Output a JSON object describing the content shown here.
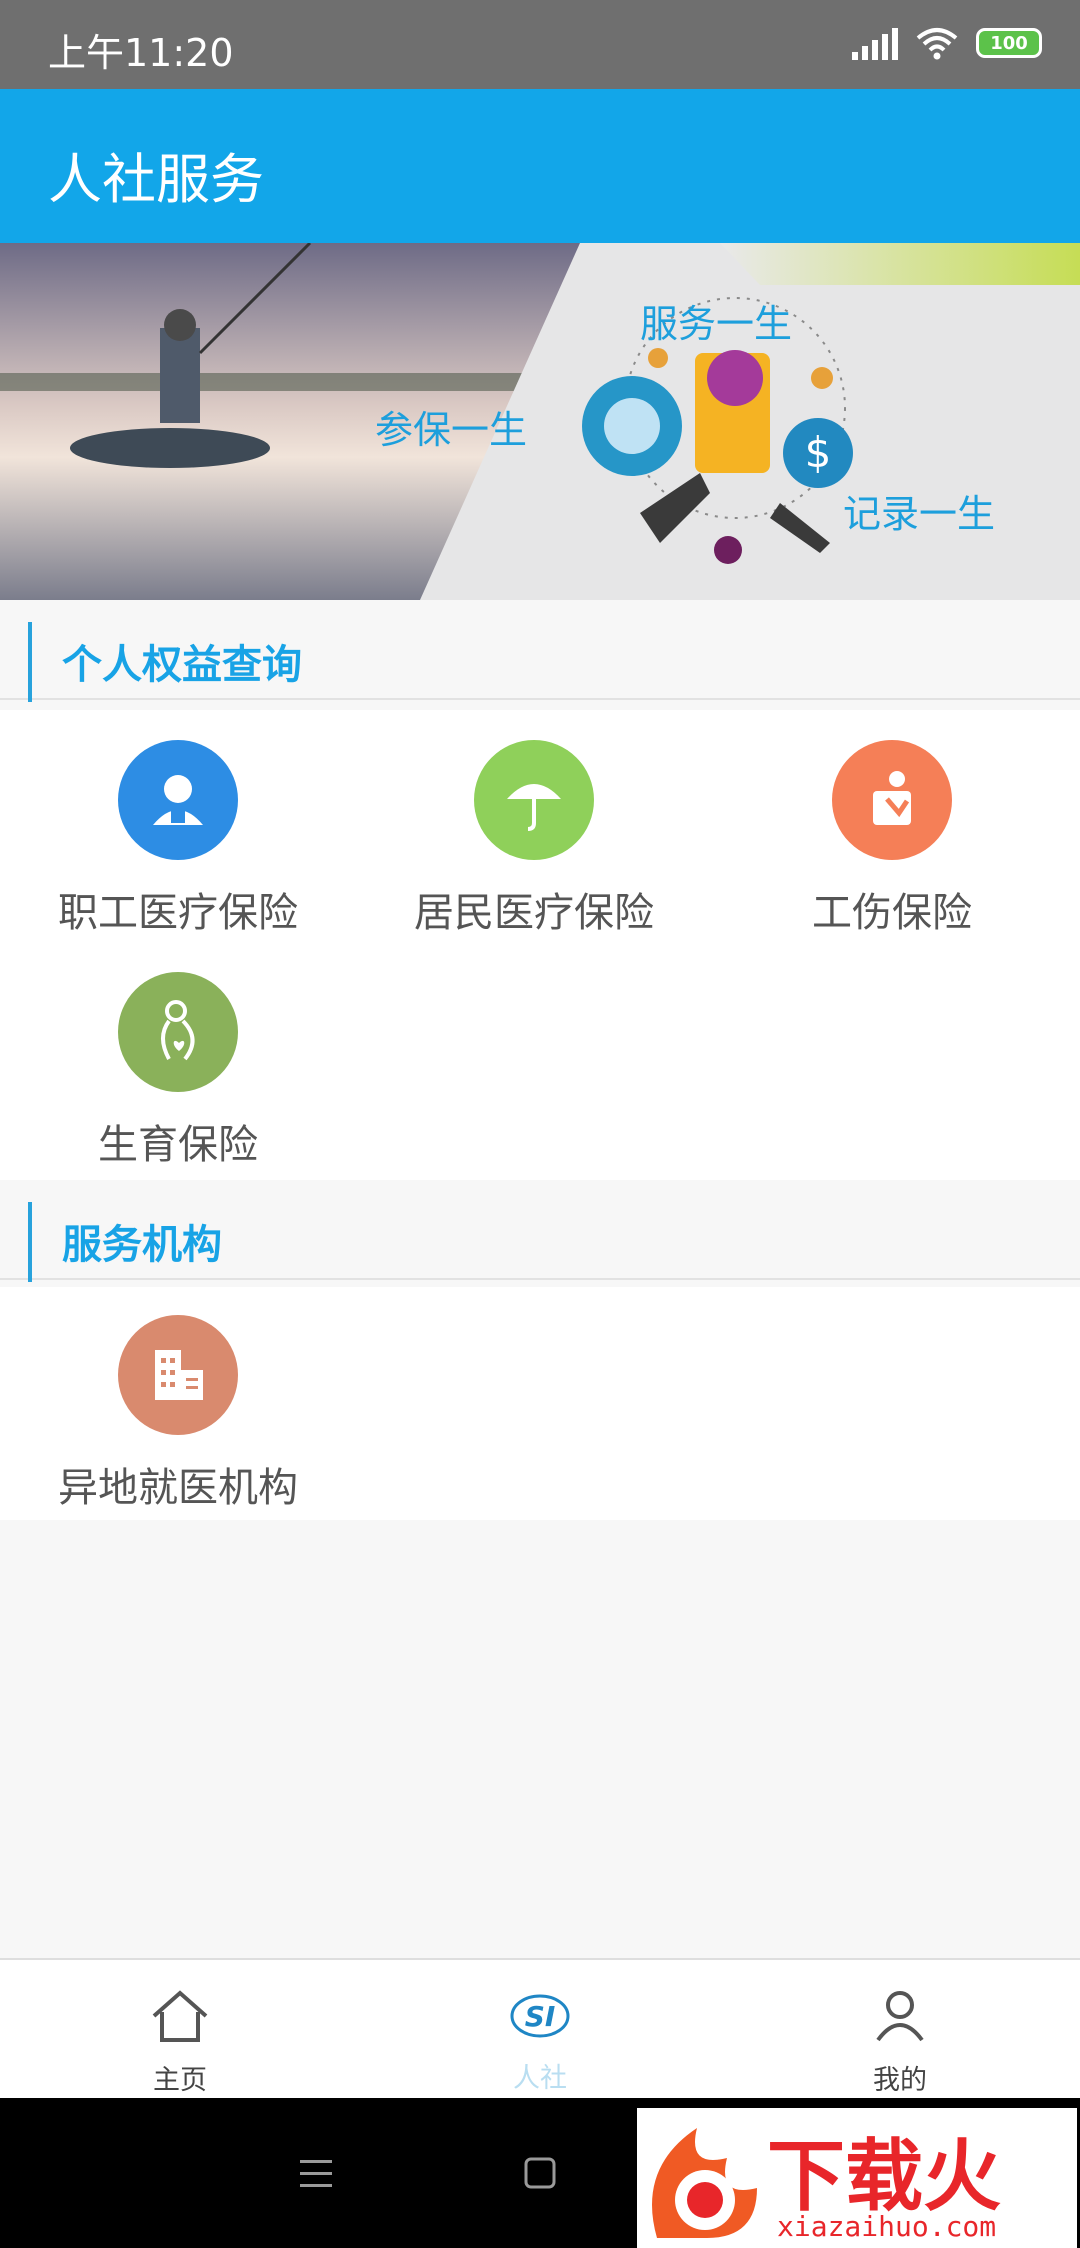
{
  "status_bar": {
    "time": "上午11:20",
    "battery": "100"
  },
  "app_bar": {
    "title": "人社服务"
  },
  "banner": {
    "text_service": "服务一生",
    "text_insure": "参保一生",
    "text_record": "记录一生"
  },
  "sections": {
    "personal": {
      "title": "个人权益查询",
      "items": [
        {
          "label": "职工医疗保险",
          "icon": "employee-icon",
          "color": "#2d8de4"
        },
        {
          "label": "居民医疗保险",
          "icon": "umbrella-icon",
          "color": "#8fd05a"
        },
        {
          "label": "工伤保险",
          "icon": "injury-icon",
          "color": "#f57f57"
        },
        {
          "label": "生育保险",
          "icon": "maternity-icon",
          "color": "#8ab15a"
        }
      ]
    },
    "institutions": {
      "title": "服务机构",
      "items": [
        {
          "label": "异地就医机构",
          "icon": "building-icon",
          "color": "#d98a6e"
        }
      ]
    }
  },
  "tab_bar": {
    "tabs": [
      {
        "label": "主页",
        "icon": "home-icon"
      },
      {
        "label": "人社",
        "icon": "si-logo-icon",
        "active": true
      },
      {
        "label": "我的",
        "icon": "person-icon"
      }
    ],
    "active_color": "#b9def1"
  },
  "watermark": {
    "brand": "下载火",
    "url": "xiazaihuo.com"
  }
}
